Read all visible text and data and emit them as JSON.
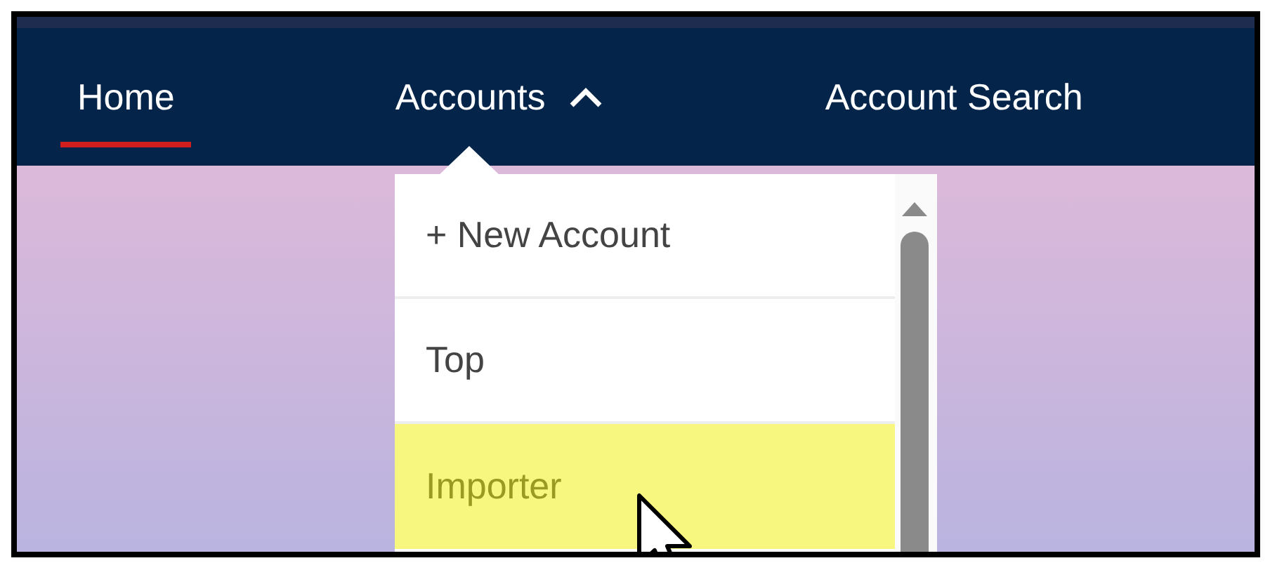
{
  "nav": {
    "tabs": [
      {
        "label": "Home",
        "selected": true
      },
      {
        "label": "Accounts",
        "selected": false,
        "expanded": true
      },
      {
        "label": "Account Search",
        "selected": false
      }
    ]
  },
  "menu": {
    "items": [
      {
        "label": "+ New Account",
        "selected": false
      },
      {
        "label": "Top",
        "selected": false
      },
      {
        "label": "Importer",
        "selected": true
      }
    ]
  }
}
